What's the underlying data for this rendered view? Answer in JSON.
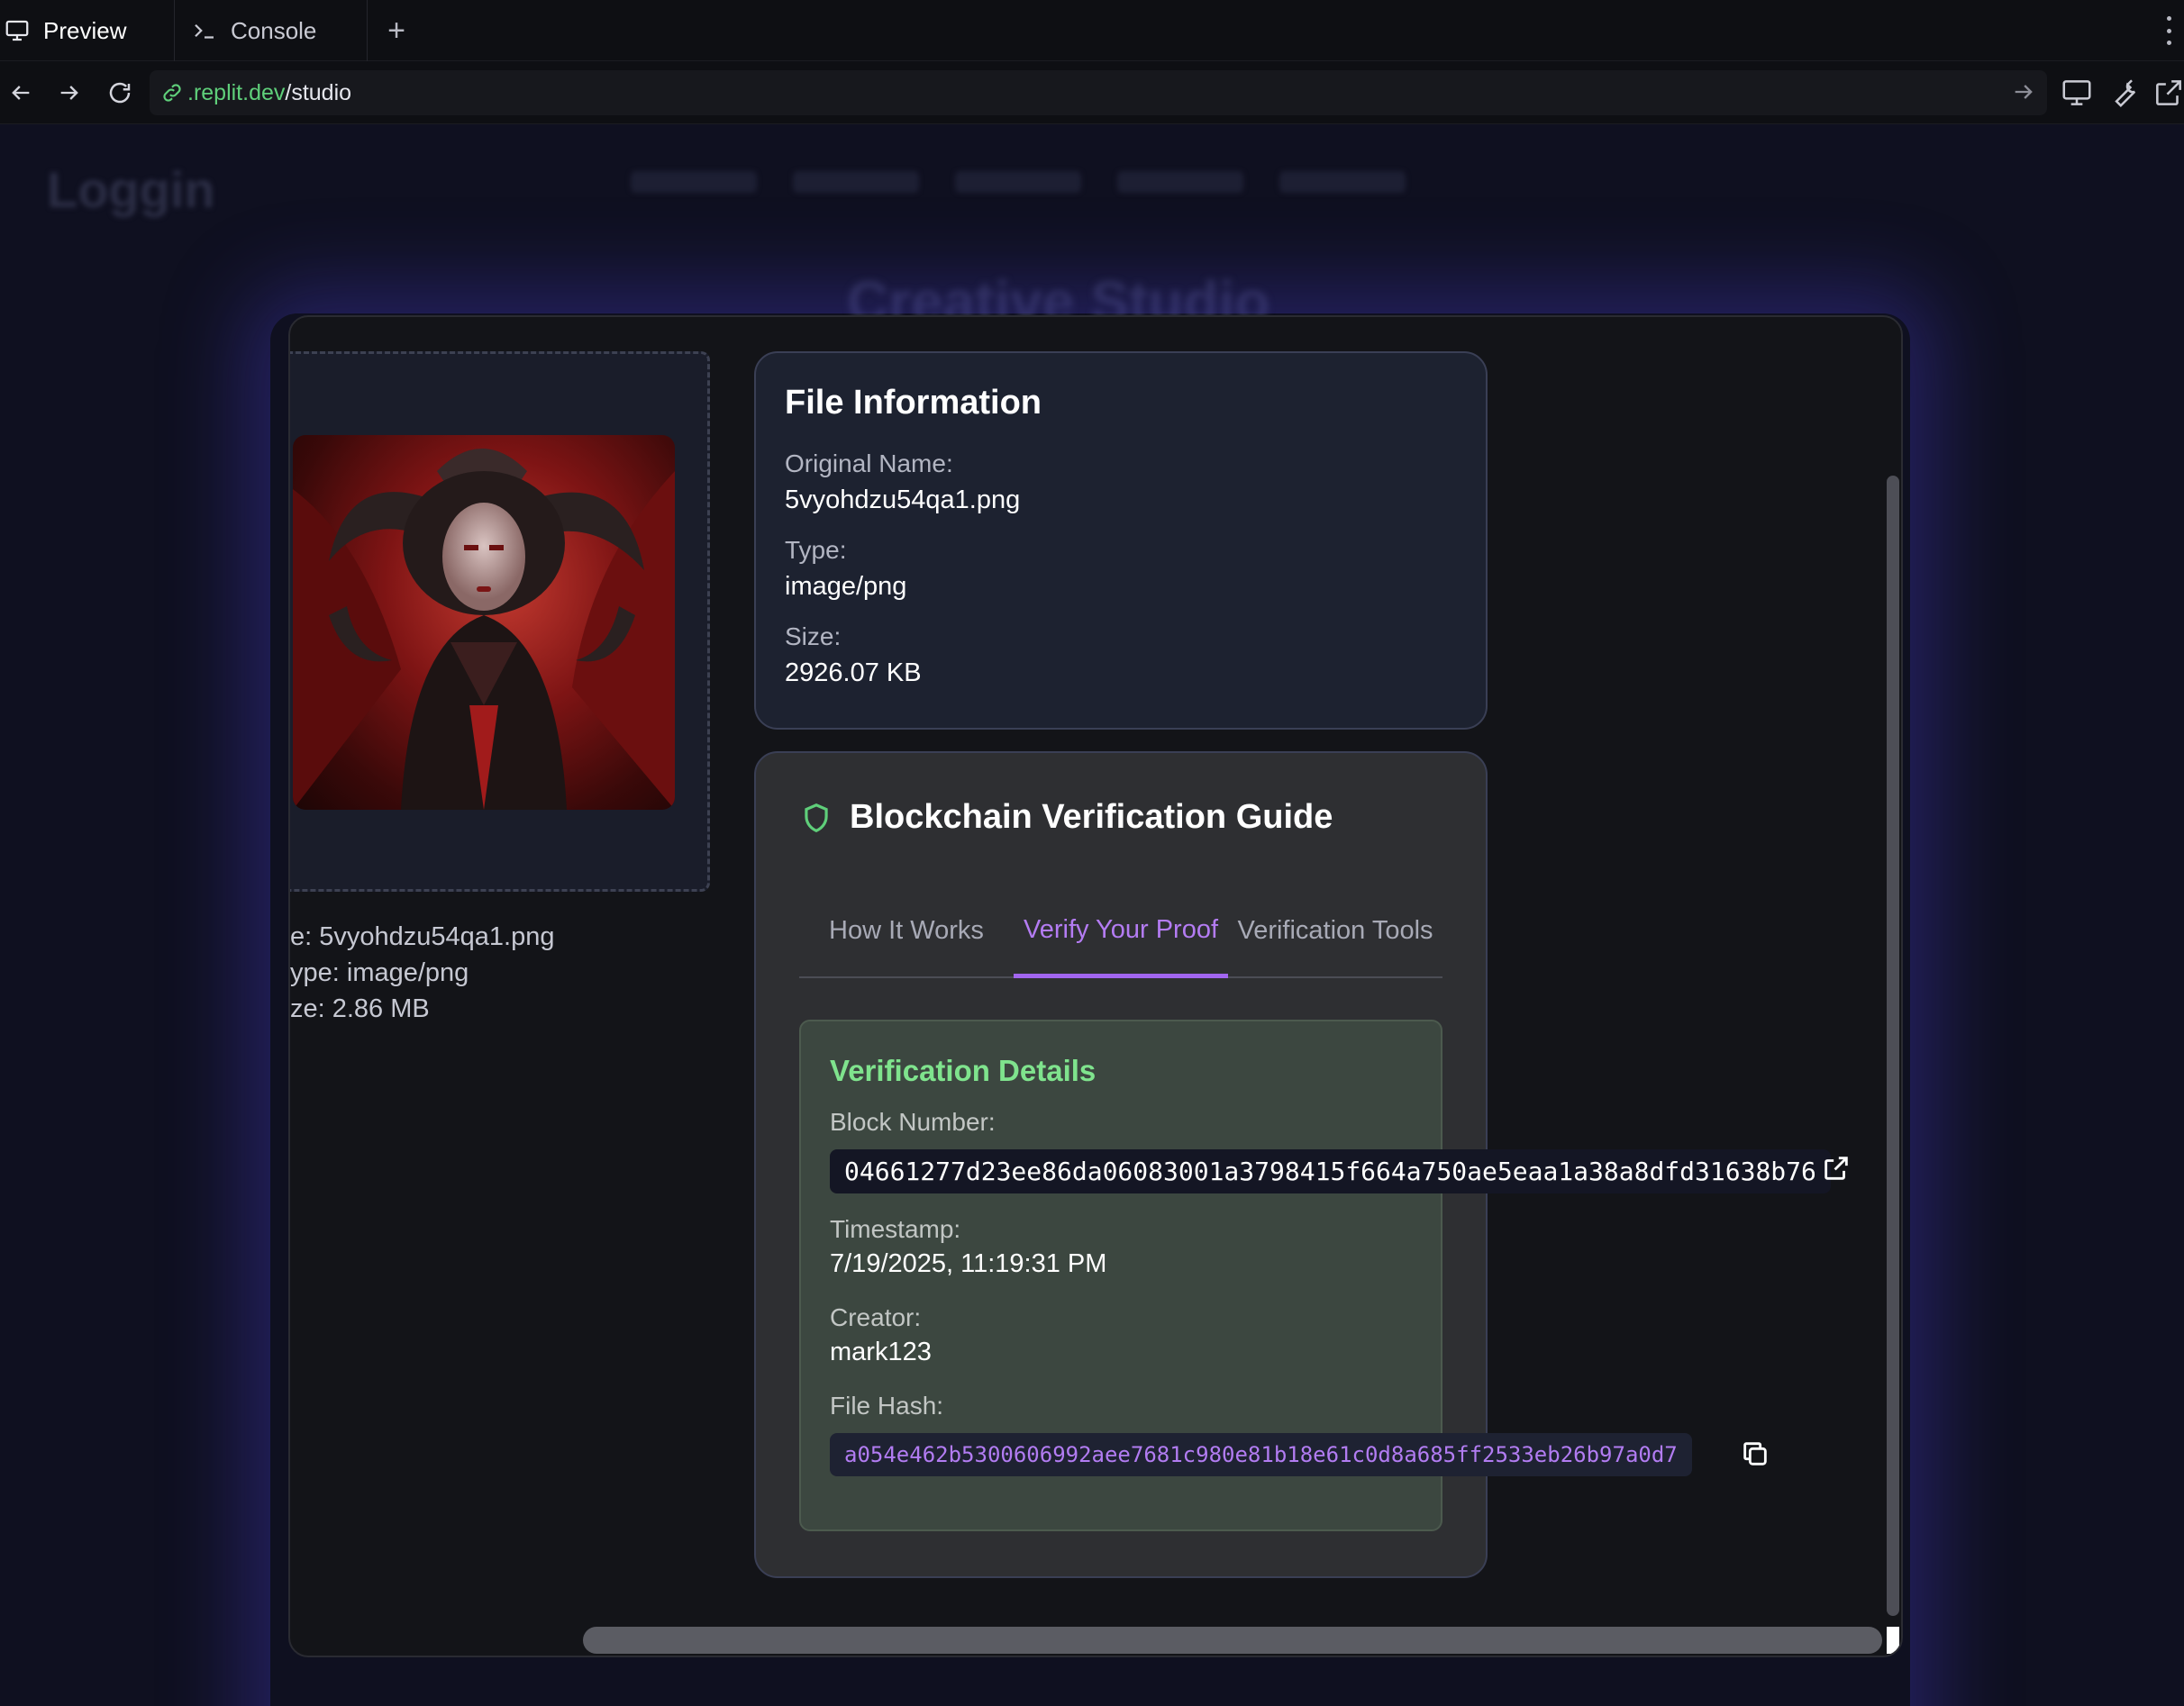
{
  "browser": {
    "tabs": [
      {
        "label": "Preview",
        "active": true
      },
      {
        "label": "Console",
        "active": false
      }
    ],
    "url_host": ".replit.dev",
    "url_path": "/studio"
  },
  "background": {
    "logo": "Loggin",
    "title": "Creative Studio"
  },
  "upload": {
    "file_meta": [
      "e: 5vyohdzu54qa1.png",
      "ype: image/png",
      "ze: 2.86 MB"
    ]
  },
  "file_info": {
    "title": "File Information",
    "fields": [
      {
        "label": "Original Name:",
        "value": "5vyohdzu54qa1.png"
      },
      {
        "label": "Type:",
        "value": "image/png"
      },
      {
        "label": "Size:",
        "value": "2926.07 KB"
      }
    ]
  },
  "guide": {
    "title": "Blockchain Verification Guide",
    "tabs": [
      {
        "label": "How It Works",
        "active": false
      },
      {
        "label": "Verify Your Proof",
        "active": true
      },
      {
        "label": "Verification Tools",
        "active": false
      }
    ],
    "details": {
      "title": "Verification Details",
      "block_label": "Block Number:",
      "block_value": "04661277d23ee86da06083001a3798415f664a750ae5eaa1a38a8dfd31638b76",
      "timestamp_label": "Timestamp:",
      "timestamp_value": "7/19/2025, 11:19:31 PM",
      "creator_label": "Creator:",
      "creator_value": "mark123",
      "hash_label": "File Hash:",
      "hash_value": "a054e462b5300606992aee7681c980e81b18e61c0d8a685ff2533eb26b97a0d7"
    }
  },
  "colors": {
    "accent_purple": "#a266f0",
    "success_green": "#7fe38d",
    "url_green": "#5fcf7a"
  }
}
